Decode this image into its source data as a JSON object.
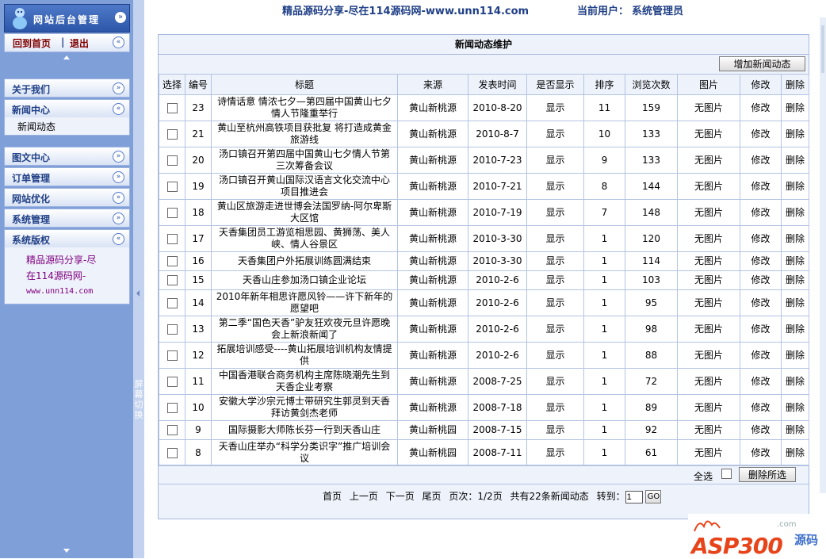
{
  "app": {
    "logo_title": "网站后台管理",
    "home_link": "回到首页",
    "separator": "|",
    "logout_link": "退出"
  },
  "top": {
    "site": "精品源码分享-尽在114源码网-www.unn114.com",
    "user_label": "当前用户：",
    "user_name": "系统管理员"
  },
  "sidebar": {
    "menus": [
      {
        "label": "关于我们",
        "expanded": false
      },
      {
        "label": "新闻中心",
        "expanded": true,
        "items": [
          "新闻动态"
        ]
      },
      {
        "label": "图文中心",
        "expanded": false
      },
      {
        "label": "订单管理",
        "expanded": false
      },
      {
        "label": "网站优化",
        "expanded": false
      },
      {
        "label": "系统管理",
        "expanded": false
      },
      {
        "label": "系统版权",
        "expanded": true
      }
    ],
    "copyright": {
      "line1": "精品源码分享-尽",
      "line2": "在114源码网-",
      "line3": "www.unn114.com"
    }
  },
  "splitter": {
    "label": "屏幕切换"
  },
  "panel": {
    "title": "新闻动态维护",
    "add_button": "增加新闻动态",
    "columns": [
      "选择",
      "编号",
      "标题",
      "来源",
      "发表时间",
      "是否显示",
      "排序",
      "浏览次数",
      "图片",
      "修改",
      "删除"
    ],
    "rows": [
      {
        "id": "23",
        "title": "诗情话意 情浓七夕—第四届中国黄山七夕情人节隆重举行",
        "source": "黄山新桃源",
        "date": "2010-8-20",
        "show": "显示",
        "order": "11",
        "views": "159",
        "image": "无图片",
        "edit": "修改",
        "del": "删除"
      },
      {
        "id": "21",
        "title": "黄山至杭州高铁项目获批复 将打造成黄金旅游线",
        "source": "黄山新桃源",
        "date": "2010-8-7",
        "show": "显示",
        "order": "10",
        "views": "133",
        "image": "无图片",
        "edit": "修改",
        "del": "删除"
      },
      {
        "id": "20",
        "title": "汤口镇召开第四届中国黄山七夕情人节第三次筹备会议",
        "source": "黄山新桃源",
        "date": "2010-7-23",
        "show": "显示",
        "order": "9",
        "views": "133",
        "image": "无图片",
        "edit": "修改",
        "del": "删除"
      },
      {
        "id": "19",
        "title": "汤口镇召开黄山国际汉语言文化交流中心项目推进会",
        "source": "黄山新桃源",
        "date": "2010-7-21",
        "show": "显示",
        "order": "8",
        "views": "144",
        "image": "无图片",
        "edit": "修改",
        "del": "删除"
      },
      {
        "id": "18",
        "title": "黄山区旅游走进世博会法国罗纳-阿尔卑斯大区馆",
        "source": "黄山新桃源",
        "date": "2010-7-19",
        "show": "显示",
        "order": "7",
        "views": "148",
        "image": "无图片",
        "edit": "修改",
        "del": "删除"
      },
      {
        "id": "17",
        "title": "天香集团员工游览相思园、黄狮荡、美人峡、情人谷景区",
        "source": "黄山新桃源",
        "date": "2010-3-30",
        "show": "显示",
        "order": "1",
        "views": "120",
        "image": "无图片",
        "edit": "修改",
        "del": "删除"
      },
      {
        "id": "16",
        "title": "天香集团户外拓展训练圆满结束",
        "source": "黄山新桃源",
        "date": "2010-3-30",
        "show": "显示",
        "order": "1",
        "views": "114",
        "image": "无图片",
        "edit": "修改",
        "del": "删除"
      },
      {
        "id": "15",
        "title": "天香山庄参加汤口镇企业论坛",
        "source": "黄山新桃源",
        "date": "2010-2-6",
        "show": "显示",
        "order": "1",
        "views": "103",
        "image": "无图片",
        "edit": "修改",
        "del": "删除"
      },
      {
        "id": "14",
        "title": "2010年新年相思许愿风铃——许下新年的愿望吧",
        "source": "黄山新桃源",
        "date": "2010-2-6",
        "show": "显示",
        "order": "1",
        "views": "95",
        "image": "无图片",
        "edit": "修改",
        "del": "删除"
      },
      {
        "id": "13",
        "title": "第二季“国色天香”驴友狂欢夜元旦许愿晚会上新浪新闻了",
        "source": "黄山新桃源",
        "date": "2010-2-6",
        "show": "显示",
        "order": "1",
        "views": "98",
        "image": "无图片",
        "edit": "修改",
        "del": "删除"
      },
      {
        "id": "12",
        "title": "拓展培训感受----黄山拓展培训机构友情提供",
        "source": "黄山新桃源",
        "date": "2010-2-6",
        "show": "显示",
        "order": "1",
        "views": "88",
        "image": "无图片",
        "edit": "修改",
        "del": "删除"
      },
      {
        "id": "11",
        "title": "中国香港联合商务机构主席陈晓潮先生到天香企业考察",
        "source": "黄山新桃源",
        "date": "2008-7-25",
        "show": "显示",
        "order": "1",
        "views": "72",
        "image": "无图片",
        "edit": "修改",
        "del": "删除"
      },
      {
        "id": "10",
        "title": "安徽大学沙宗元博士带研究生郭灵到天香拜访黄剑杰老师",
        "source": "黄山新桃源",
        "date": "2008-7-18",
        "show": "显示",
        "order": "1",
        "views": "89",
        "image": "无图片",
        "edit": "修改",
        "del": "删除"
      },
      {
        "id": "9",
        "title": "国际摄影大师陈长芬一行到天香山庄",
        "source": "黄山新桃园",
        "date": "2008-7-15",
        "show": "显示",
        "order": "1",
        "views": "92",
        "image": "无图片",
        "edit": "修改",
        "del": "删除"
      },
      {
        "id": "8",
        "title": "天香山庄举办“科学分类识字”推广培训会议",
        "source": "黄山新桃园",
        "date": "2008-7-11",
        "show": "显示",
        "order": "1",
        "views": "61",
        "image": "无图片",
        "edit": "修改",
        "del": "删除"
      }
    ],
    "select_all": "全选",
    "delete_selected": "删除所选",
    "pager": {
      "first": "首页",
      "prev": "上一页",
      "next": "下一页",
      "last": "尾页",
      "page_info": "页次：1/2页",
      "total": "共有22条新闻动态",
      "goto_label": "转到：",
      "goto_value": "1",
      "go": "GO"
    }
  },
  "watermark": {
    "brand": "ASP300",
    "suffix": "源码",
    "tld": ".com"
  },
  "colors": {
    "sidebar_bg": "#7f9fd9",
    "menu_text": "#1f3f86",
    "link_red": "#800000",
    "panel_bg": "#eef3fb"
  }
}
